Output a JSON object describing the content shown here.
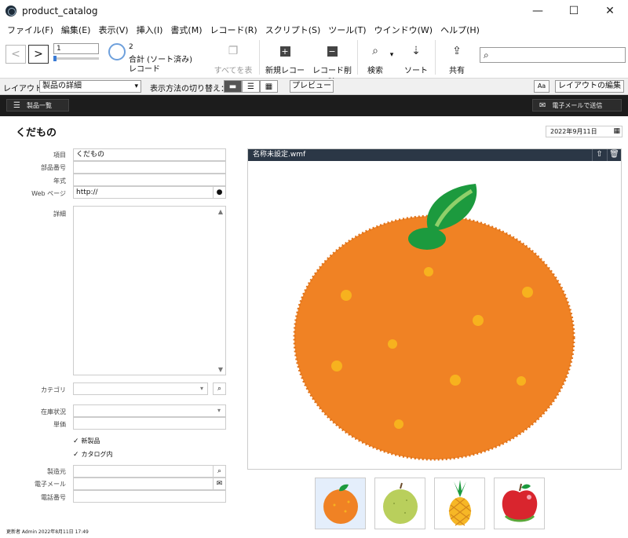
{
  "window": {
    "title": "product_catalog",
    "minimize": "—",
    "maximize": "☐",
    "close": "✕"
  },
  "menu": [
    "ファイル(F)",
    "編集(E)",
    "表示(V)",
    "挿入(I)",
    "書式(M)",
    "レコード(R)",
    "スクリプト(S)",
    "ツール(T)",
    "ウインドウ(W)",
    "ヘルプ(H)"
  ],
  "toolbar": {
    "record_number": "1",
    "found_count": "2",
    "total_label": "合計 (ソート済み)",
    "records_label": "レコード",
    "show_all": "すべてを表示",
    "new_record": "新規レコード",
    "delete_record": "レコード削除",
    "find": "検索",
    "sort": "ソート",
    "share": "共有"
  },
  "layoutbar": {
    "layout_label": "レイアウト：",
    "layout_value": "製品の詳細",
    "view_label": "表示方法の切り替え：",
    "preview": "プレビュー",
    "aa": "Aa",
    "edit_layout": "レイアウトの編集"
  },
  "band": {
    "product_list": "製品一覧",
    "email_send": "電子メールで送信"
  },
  "record": {
    "title": "くだもの",
    "date": "2022年9月11日",
    "fields": {
      "item_label": "項目",
      "item_value": "くだもの",
      "part_label": "部品番号",
      "part_value": "",
      "year_label": "年式",
      "year_value": "",
      "web_label": "Web ページ",
      "web_value": "http://",
      "detail_label": "詳細",
      "category_label": "カテゴリ",
      "category_value": "",
      "stock_label": "在庫状況",
      "stock_value": "",
      "price_label": "単価",
      "price_value": "",
      "new_product": "新製品",
      "catalog": "カタログ内",
      "maker_label": "製造元",
      "maker_value": "",
      "email_label": "電子メール",
      "email_value": "",
      "phone_label": "電話番号",
      "phone_value": ""
    },
    "image_name": "名称未設定.wmf",
    "thumbnails": [
      "orange",
      "pear",
      "pineapple",
      "apple"
    ],
    "footer": "更新者 Admin 2022年8月11日 17:49"
  },
  "colors": {
    "orange": "#f08224",
    "leaf": "#1c9a3e",
    "band": "#1c1c1c",
    "image_header": "#2b3746",
    "accent": "#3a7bd5"
  }
}
